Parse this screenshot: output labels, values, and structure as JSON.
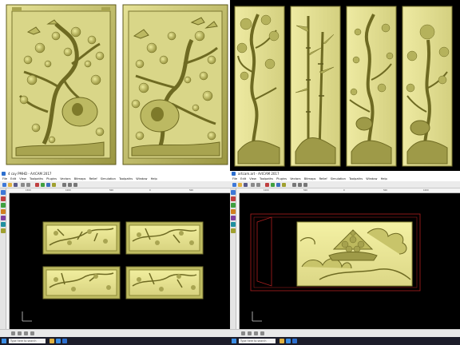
{
  "colors": {
    "relief_face": "#c8c76a",
    "relief_light": "#e2df8e",
    "relief_shadow": "#6e6a22",
    "frame_dark": "#5e5a1c",
    "canvas_bg": "#000000",
    "selection_red": "#b02020",
    "toolbar_bg": "#ebebeb"
  },
  "top_left": {
    "description_icons": [
      "plum-blossom-relief-panel",
      "plum-blossom-relief-panel"
    ]
  },
  "top_right": {
    "panels": [
      "pine-tree-relief-panel",
      "bamboo-relief-panel",
      "plum-relief-panel",
      "lotus-relief-panel"
    ]
  },
  "window_left": {
    "title": "4 cay PMHD - ArtCAM 2017",
    "menus": [
      "File",
      "Edit",
      "View",
      "Toolpaths",
      "Plugins",
      "Vectors",
      "Bitmaps",
      "Relief",
      "Simulation",
      "Toolpaths",
      "Window",
      "Help"
    ],
    "ruler_marks": [
      "1500",
      "1000",
      "500",
      "0",
      "500"
    ],
    "status": "X: 3.5  Y: 1.8  Z: 0.00",
    "search_placeholder": "Type here to search"
  },
  "window_right": {
    "title": "artcam.art - ArtCAM 2017",
    "menus": [
      "File",
      "Edit",
      "View",
      "Toolpaths",
      "Plugins",
      "Vectors",
      "Bitmaps",
      "Relief",
      "Simulation",
      "Toolpaths",
      "Window",
      "Help"
    ],
    "ruler_marks": [
      "1000",
      "500",
      "0",
      "500",
      "1000"
    ],
    "status": "X: 12.1  Y: 4.0  Z: 0.00",
    "search_placeholder": "Type here to search"
  }
}
